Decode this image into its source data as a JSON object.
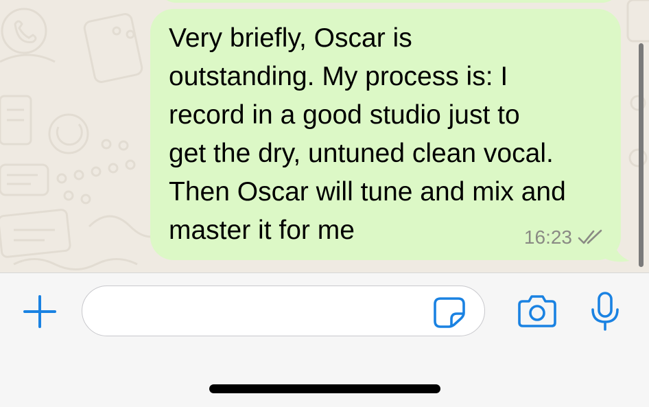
{
  "chat": {
    "message": {
      "text": "Very briefly, Oscar is\noutstanding. My process is: I\nrecord in a good studio just to\nget the dry, untuned clean vocal.\nThen Oscar will tune and mix and\nmaster it for me",
      "time": "16:23",
      "status_icon": "double-check-icon",
      "direction": "outgoing"
    }
  },
  "input_bar": {
    "value": "",
    "placeholder": "",
    "icons": {
      "attach": "plus-icon",
      "sticker": "sticker-icon",
      "camera": "camera-icon",
      "mic": "microphone-icon"
    }
  },
  "colors": {
    "bubble": "#dcf8c6",
    "wallpaper": "#efeae2",
    "accent": "#1a82e2",
    "time_text": "#8a8a84"
  }
}
